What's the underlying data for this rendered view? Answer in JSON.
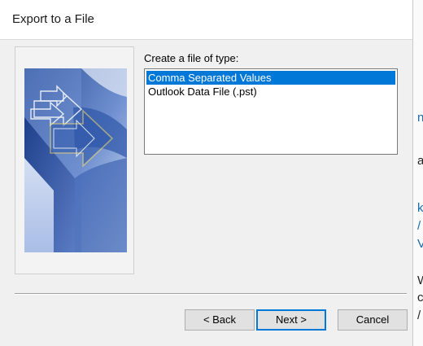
{
  "window": {
    "title": "Export to a File"
  },
  "content": {
    "file_type_label": "Create a file of type:",
    "file_types": [
      {
        "label": "Comma Separated Values",
        "selected": true
      },
      {
        "label": "Outlook Data File (.pst)",
        "selected": false
      }
    ]
  },
  "buttons": {
    "back": "< Back",
    "next": "Next >",
    "cancel": "Cancel"
  },
  "background_fragments": [
    "n",
    "a",
    "k",
    "/",
    "V",
    "W",
    "c",
    "/"
  ],
  "colors": {
    "selection": "#0078d7",
    "default_button_border": "#0078d7",
    "link_text": "#1a6aa8"
  }
}
